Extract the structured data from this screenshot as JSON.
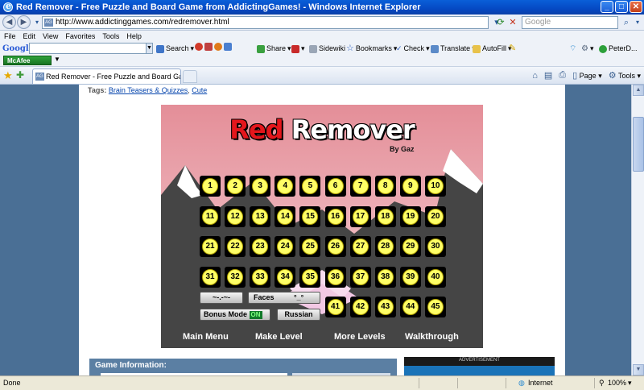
{
  "window": {
    "title": "Red Remover - Free Puzzle and Board Game from AddictingGames! - Windows Internet Explorer",
    "buttons": {
      "minimize": "_",
      "maximize": "□",
      "close": "✕"
    }
  },
  "address_bar": {
    "url": "http://www.addictinggames.com/redremover.html",
    "search_placeholder": "Google"
  },
  "menu": [
    "File",
    "Edit",
    "View",
    "Favorites",
    "Tools",
    "Help"
  ],
  "google_toolbar": {
    "logo": "Google",
    "items": [
      "Search",
      "Share",
      "Sidewiki",
      "Bookmarks",
      "Check",
      "Translate",
      "AutoFill"
    ],
    "user": "PeterD..."
  },
  "mcafee": {
    "label": "McAfee"
  },
  "tabs": {
    "active_title": "Red Remover - Free Puzzle and Board Game from Addic...",
    "commands": [
      "Page",
      "Tools"
    ]
  },
  "page": {
    "tags_label": "Tags:",
    "tags": [
      "Brain Teasers & Quizzes",
      "Cute"
    ]
  },
  "game": {
    "title_red": "Red",
    "title_white": "Remover",
    "byline": "By Gaz",
    "levels": [
      [
        "1",
        "2",
        "3",
        "4",
        "5",
        "6",
        "7",
        "8",
        "9",
        "10"
      ],
      [
        "11",
        "12",
        "13",
        "14",
        "15",
        "16",
        "17",
        "18",
        "19",
        "20"
      ],
      [
        "21",
        "22",
        "23",
        "24",
        "25",
        "26",
        "27",
        "28",
        "29",
        "30"
      ],
      [
        "31",
        "32",
        "33",
        "34",
        "35",
        "36",
        "37",
        "38",
        "39",
        "40"
      ],
      [
        "41",
        "42",
        "43",
        "44",
        "45"
      ]
    ],
    "buttons": {
      "style": "~-.-~-",
      "faces": "Faces",
      "faces_glyph": "°_°",
      "bonus_mode": "Bonus Mode",
      "bonus_state": "ON",
      "language": "Russian"
    },
    "menu": [
      "Main Menu",
      "Make Level",
      "More Levels",
      "Walkthrough"
    ]
  },
  "game_info": {
    "heading": "Game Information:"
  },
  "advertisement": {
    "label": "ADVERTISEMENT"
  },
  "status": {
    "text": "Done",
    "zone": "Internet",
    "zoom": "100%"
  }
}
